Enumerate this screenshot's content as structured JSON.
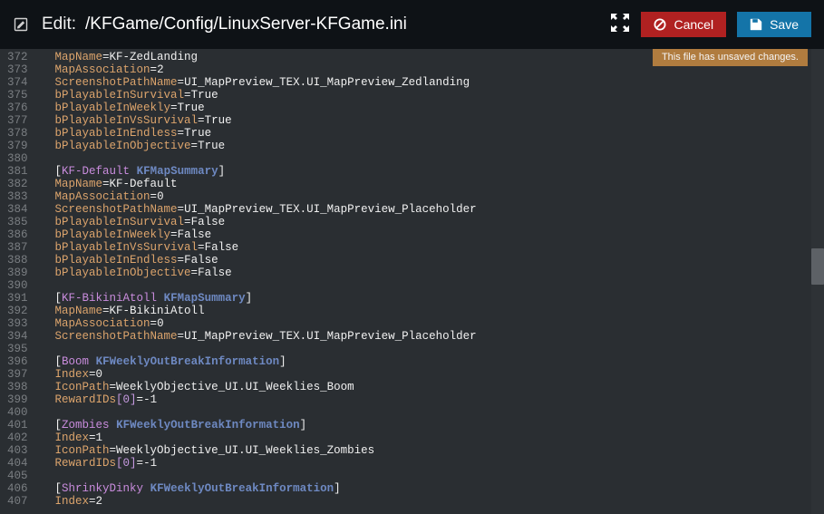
{
  "header": {
    "edit_label": "Edit:",
    "path": "/KFGame/Config/LinuxServer-KFGame.ini",
    "cancel_label": "Cancel",
    "save_label": "Save"
  },
  "banner": {
    "unsaved": "This file has unsaved changes."
  },
  "startLine": 372,
  "code": [
    [
      [
        "prop",
        "MapName"
      ],
      [
        "punct",
        "="
      ],
      [
        "val",
        "KF-ZedLanding"
      ]
    ],
    [
      [
        "prop",
        "MapAssociation"
      ],
      [
        "punct",
        "="
      ],
      [
        "val",
        "2"
      ]
    ],
    [
      [
        "prop",
        "ScreenshotPathName"
      ],
      [
        "punct",
        "="
      ],
      [
        "val",
        "UI_MapPreview_TEX.UI_MapPreview_Zedlanding"
      ]
    ],
    [
      [
        "prop",
        "bPlayableInSurvival"
      ],
      [
        "punct",
        "="
      ],
      [
        "val",
        "True"
      ]
    ],
    [
      [
        "prop",
        "bPlayableInWeekly"
      ],
      [
        "punct",
        "="
      ],
      [
        "val",
        "True"
      ]
    ],
    [
      [
        "prop",
        "bPlayableInVsSurvival"
      ],
      [
        "punct",
        "="
      ],
      [
        "val",
        "True"
      ]
    ],
    [
      [
        "prop",
        "bPlayableInEndless"
      ],
      [
        "punct",
        "="
      ],
      [
        "val",
        "True"
      ]
    ],
    [
      [
        "prop",
        "bPlayableInObjective"
      ],
      [
        "punct",
        "="
      ],
      [
        "val",
        "True"
      ]
    ],
    [],
    [
      [
        "punct",
        "["
      ],
      [
        "brkey",
        "KF-Default"
      ],
      [
        "punct",
        " "
      ],
      [
        "section",
        "KFMapSummary"
      ],
      [
        "punct",
        "]"
      ]
    ],
    [
      [
        "prop",
        "MapName"
      ],
      [
        "punct",
        "="
      ],
      [
        "val",
        "KF-Default"
      ]
    ],
    [
      [
        "prop",
        "MapAssociation"
      ],
      [
        "punct",
        "="
      ],
      [
        "val",
        "0"
      ]
    ],
    [
      [
        "prop",
        "ScreenshotPathName"
      ],
      [
        "punct",
        "="
      ],
      [
        "val",
        "UI_MapPreview_TEX.UI_MapPreview_Placeholder"
      ]
    ],
    [
      [
        "prop",
        "bPlayableInSurvival"
      ],
      [
        "punct",
        "="
      ],
      [
        "val",
        "False"
      ]
    ],
    [
      [
        "prop",
        "bPlayableInWeekly"
      ],
      [
        "punct",
        "="
      ],
      [
        "val",
        "False"
      ]
    ],
    [
      [
        "prop",
        "bPlayableInVsSurvival"
      ],
      [
        "punct",
        "="
      ],
      [
        "val",
        "False"
      ]
    ],
    [
      [
        "prop",
        "bPlayableInEndless"
      ],
      [
        "punct",
        "="
      ],
      [
        "val",
        "False"
      ]
    ],
    [
      [
        "prop",
        "bPlayableInObjective"
      ],
      [
        "punct",
        "="
      ],
      [
        "val",
        "False"
      ]
    ],
    [],
    [
      [
        "punct",
        "["
      ],
      [
        "brkey",
        "KF-BikiniAtoll"
      ],
      [
        "punct",
        " "
      ],
      [
        "section",
        "KFMapSummary"
      ],
      [
        "punct",
        "]"
      ]
    ],
    [
      [
        "prop",
        "MapName"
      ],
      [
        "punct",
        "="
      ],
      [
        "val",
        "KF-BikiniAtoll"
      ]
    ],
    [
      [
        "prop",
        "MapAssociation"
      ],
      [
        "punct",
        "="
      ],
      [
        "val",
        "0"
      ]
    ],
    [
      [
        "prop",
        "ScreenshotPathName"
      ],
      [
        "punct",
        "="
      ],
      [
        "val",
        "UI_MapPreview_TEX.UI_MapPreview_Placeholder"
      ]
    ],
    [],
    [
      [
        "punct",
        "["
      ],
      [
        "brkey",
        "Boom"
      ],
      [
        "punct",
        " "
      ],
      [
        "section",
        "KFWeeklyOutBreakInformation"
      ],
      [
        "punct",
        "]"
      ]
    ],
    [
      [
        "prop",
        "Index"
      ],
      [
        "punct",
        "="
      ],
      [
        "val",
        "0"
      ]
    ],
    [
      [
        "prop",
        "IconPath"
      ],
      [
        "punct",
        "="
      ],
      [
        "val",
        "WeeklyObjective_UI.UI_Weeklies_Boom"
      ]
    ],
    [
      [
        "prop",
        "RewardIDs"
      ],
      [
        "key",
        "[0]"
      ],
      [
        "punct",
        "="
      ],
      [
        "val",
        "-1"
      ]
    ],
    [],
    [
      [
        "punct",
        "["
      ],
      [
        "brkey",
        "Zombies"
      ],
      [
        "punct",
        " "
      ],
      [
        "section",
        "KFWeeklyOutBreakInformation"
      ],
      [
        "punct",
        "]"
      ]
    ],
    [
      [
        "prop",
        "Index"
      ],
      [
        "punct",
        "="
      ],
      [
        "val",
        "1"
      ]
    ],
    [
      [
        "prop",
        "IconPath"
      ],
      [
        "punct",
        "="
      ],
      [
        "val",
        "WeeklyObjective_UI.UI_Weeklies_Zombies"
      ]
    ],
    [
      [
        "prop",
        "RewardIDs"
      ],
      [
        "key",
        "[0]"
      ],
      [
        "punct",
        "="
      ],
      [
        "val",
        "-1"
      ]
    ],
    [],
    [
      [
        "punct",
        "["
      ],
      [
        "brkey",
        "ShrinkyDinky"
      ],
      [
        "punct",
        " "
      ],
      [
        "section",
        "KFWeeklyOutBreakInformation"
      ],
      [
        "punct",
        "]"
      ]
    ],
    [
      [
        "prop",
        "Index"
      ],
      [
        "punct",
        "="
      ],
      [
        "val",
        "2"
      ]
    ]
  ]
}
